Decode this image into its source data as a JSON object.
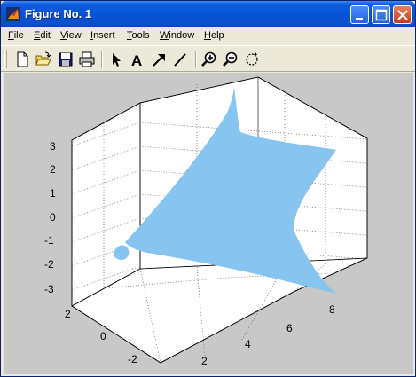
{
  "window": {
    "title": "Figure No. 1",
    "app_icon": "matlab-icon",
    "controls": [
      "minimize-icon",
      "maximize-icon",
      "close-icon"
    ]
  },
  "menubar": {
    "items": [
      {
        "label": "File",
        "accel": "F"
      },
      {
        "label": "Edit",
        "accel": "E"
      },
      {
        "label": "View",
        "accel": "V"
      },
      {
        "label": "Insert",
        "accel": "I"
      },
      {
        "label": "Tools",
        "accel": "T"
      },
      {
        "label": "Window",
        "accel": "W"
      },
      {
        "label": "Help",
        "accel": "H"
      }
    ]
  },
  "toolbar": {
    "tools": [
      "new-figure-icon",
      "open-file-icon",
      "save-icon",
      "print-icon",
      "select-arrow-icon",
      "insert-text-icon",
      "insert-arrow-icon",
      "insert-line-icon",
      "zoom-in-icon",
      "zoom-out-icon",
      "rotate-3d-icon"
    ],
    "text_tool_label": "A"
  },
  "colors": {
    "title_bar": "#0653d6",
    "surface_fill": "#87c4f0",
    "figure_background": "#c8c8c8",
    "axes_background": "#ffffff"
  },
  "chart_data": {
    "type": "surface",
    "title": "",
    "xlabel": "",
    "ylabel": "",
    "zlabel": "",
    "x_ticks": [
      "2",
      "4",
      "6",
      "8"
    ],
    "y_ticks": [
      "-2",
      "0",
      "2"
    ],
    "z_ticks": [
      "3",
      "2",
      "1",
      "0",
      "-1",
      "-2",
      "-3"
    ],
    "xlim": [
      1,
      9
    ],
    "ylim": [
      -3,
      3
    ],
    "zlim": [
      -3,
      3
    ],
    "grid": true,
    "surface_color": "#87c4f0"
  }
}
